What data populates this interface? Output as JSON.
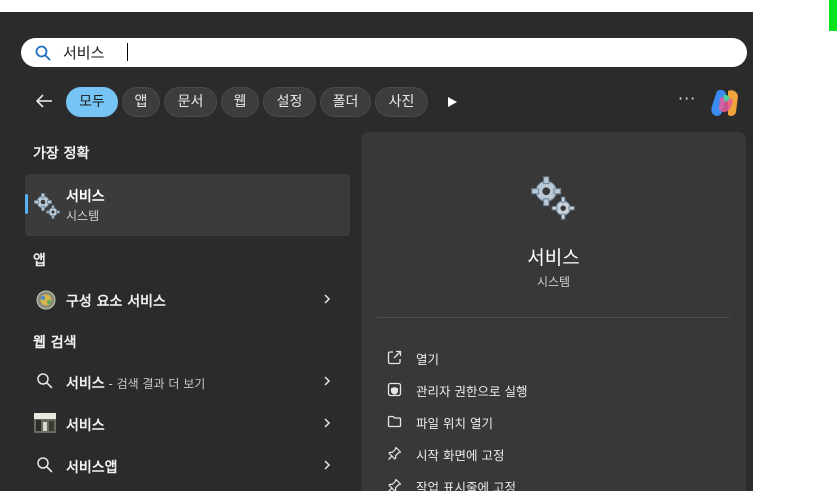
{
  "search": {
    "value": "서비스"
  },
  "filters": {
    "tabs": [
      {
        "label": "모두",
        "active": true
      },
      {
        "label": "앱"
      },
      {
        "label": "문서"
      },
      {
        "label": "웹"
      },
      {
        "label": "설정"
      },
      {
        "label": "폴더"
      },
      {
        "label": "사진"
      }
    ]
  },
  "best_match": {
    "heading": "가장 정확",
    "title": "서비스",
    "subtitle": "시스템"
  },
  "apps": {
    "heading": "앱",
    "items": [
      {
        "label": "구성 요소 서비스",
        "icon": "component-services-icon"
      }
    ]
  },
  "web": {
    "heading": "웹 검색",
    "items": [
      {
        "label": "서비스",
        "suffix": " - 검색 결과 더 보기",
        "icon": "search-icon"
      },
      {
        "label": "서비스",
        "icon": "image-thumbnail-icon"
      },
      {
        "label": "서비스앱",
        "icon": "search-icon"
      }
    ]
  },
  "preview": {
    "title": "서비스",
    "subtitle": "시스템",
    "actions": [
      {
        "label": "열기",
        "icon": "open-external-icon"
      },
      {
        "label": "관리자 권한으로 실행",
        "icon": "admin-shield-icon"
      },
      {
        "label": "파일 위치 열기",
        "icon": "folder-icon"
      },
      {
        "label": "시작 화면에 고정",
        "icon": "pin-icon"
      },
      {
        "label": "작업 표시줄에 고정",
        "icon": "pin-icon"
      }
    ]
  },
  "colors": {
    "accent": "#76c4f5",
    "panel": "#2b2b2b",
    "preview_panel": "#383838",
    "selection": "#3b3b3b"
  }
}
